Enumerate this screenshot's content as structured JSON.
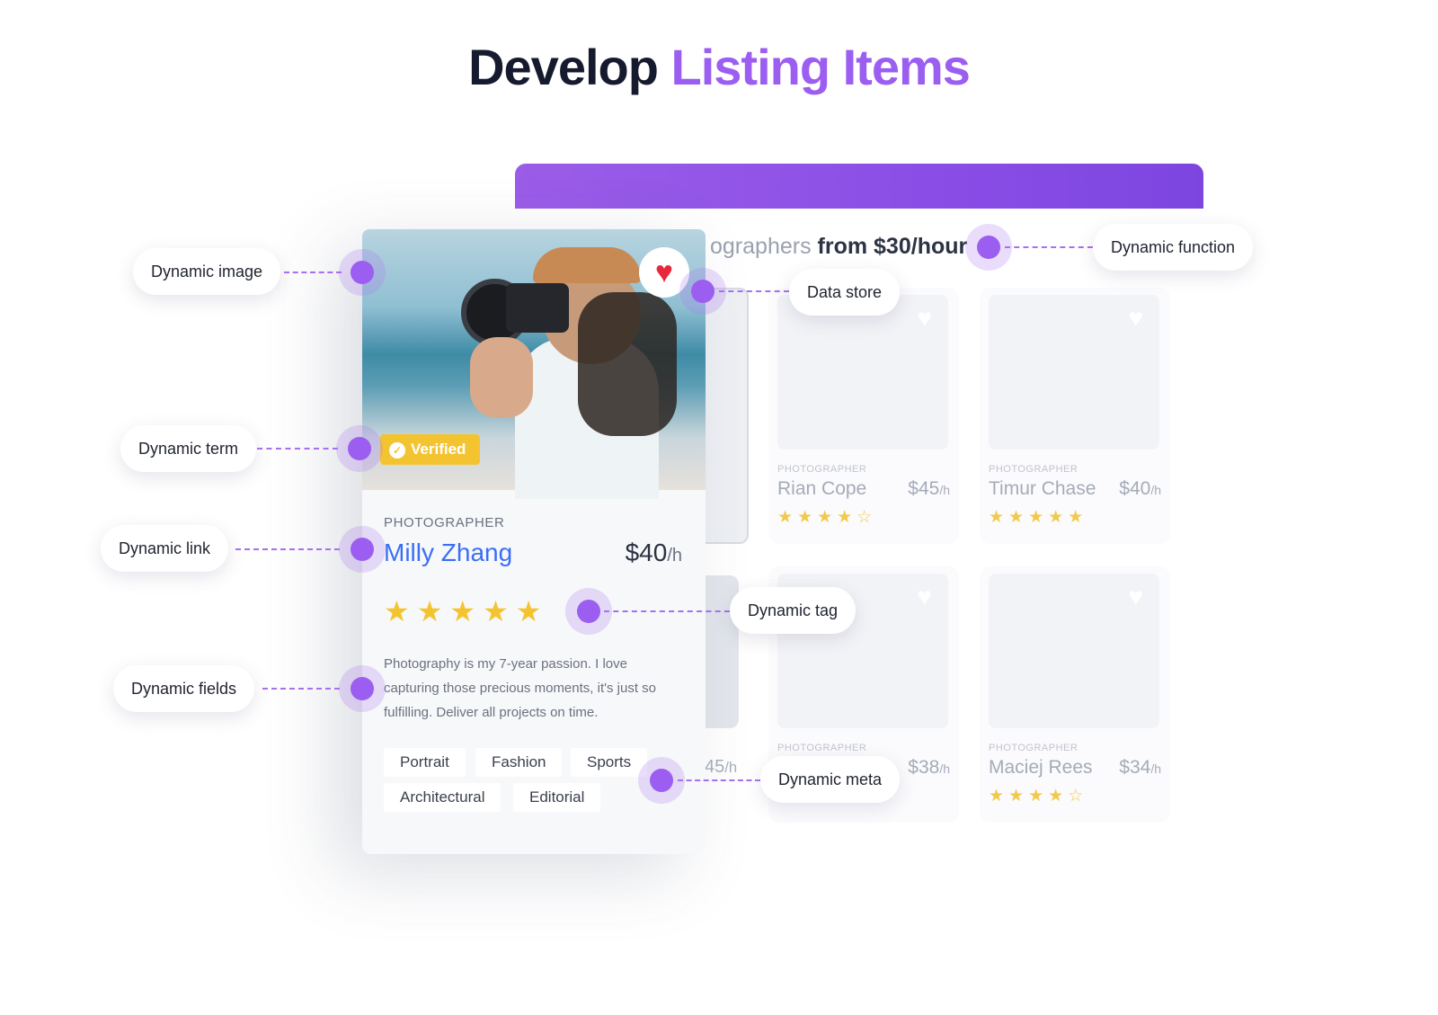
{
  "title": {
    "part1": "Develop",
    "part2": "Listing Items",
    "accent_color": "#9b5ef0"
  },
  "listing": {
    "subhead_light": "ographers",
    "subhead_bold": "from $30/hour",
    "bar_color": "#8a4ee6",
    "ghost_price": "45",
    "ghost_unit": "/h",
    "cards": [
      {
        "role": "PHOTOGRAPHER",
        "name": "Rian Cope",
        "price": "$45",
        "unit": "/h",
        "stars": "★★★★☆",
        "rating": 4
      },
      {
        "role": "PHOTOGRAPHER",
        "name": "Timur Chase",
        "price": "$40",
        "unit": "/h",
        "stars": "★★★★★",
        "rating": 5
      },
      {
        "role": "PHOTOGRAPHER",
        "name": "",
        "price": "$38",
        "unit": "/h",
        "stars": "",
        "rating": null
      },
      {
        "role": "PHOTOGRAPHER",
        "name": "Maciej Rees",
        "price": "$34",
        "unit": "/h",
        "stars": "★★★★☆",
        "rating": 4
      }
    ]
  },
  "featured": {
    "badge": "Verified",
    "role": "PHOTOGRAPHER",
    "name": "Milly Zhang",
    "price": "$40",
    "unit": "/h",
    "stars": "★★★★★",
    "rating": 5,
    "bio": "Photography is my 7-year passion. I love capturing those precious moments, it's just so fulfilling. Deliver all projects on time.",
    "tags": [
      "Portrait",
      "Fashion",
      "Sports",
      "Architectural",
      "Editorial"
    ],
    "name_color": "#3b6ef5"
  },
  "annotations": {
    "image": "Dynamic image",
    "function": "Dynamic function",
    "store": "Data store",
    "term": "Dynamic term",
    "link": "Dynamic link",
    "tag": "Dynamic tag",
    "fields": "Dynamic fields",
    "meta": "Dynamic meta"
  }
}
